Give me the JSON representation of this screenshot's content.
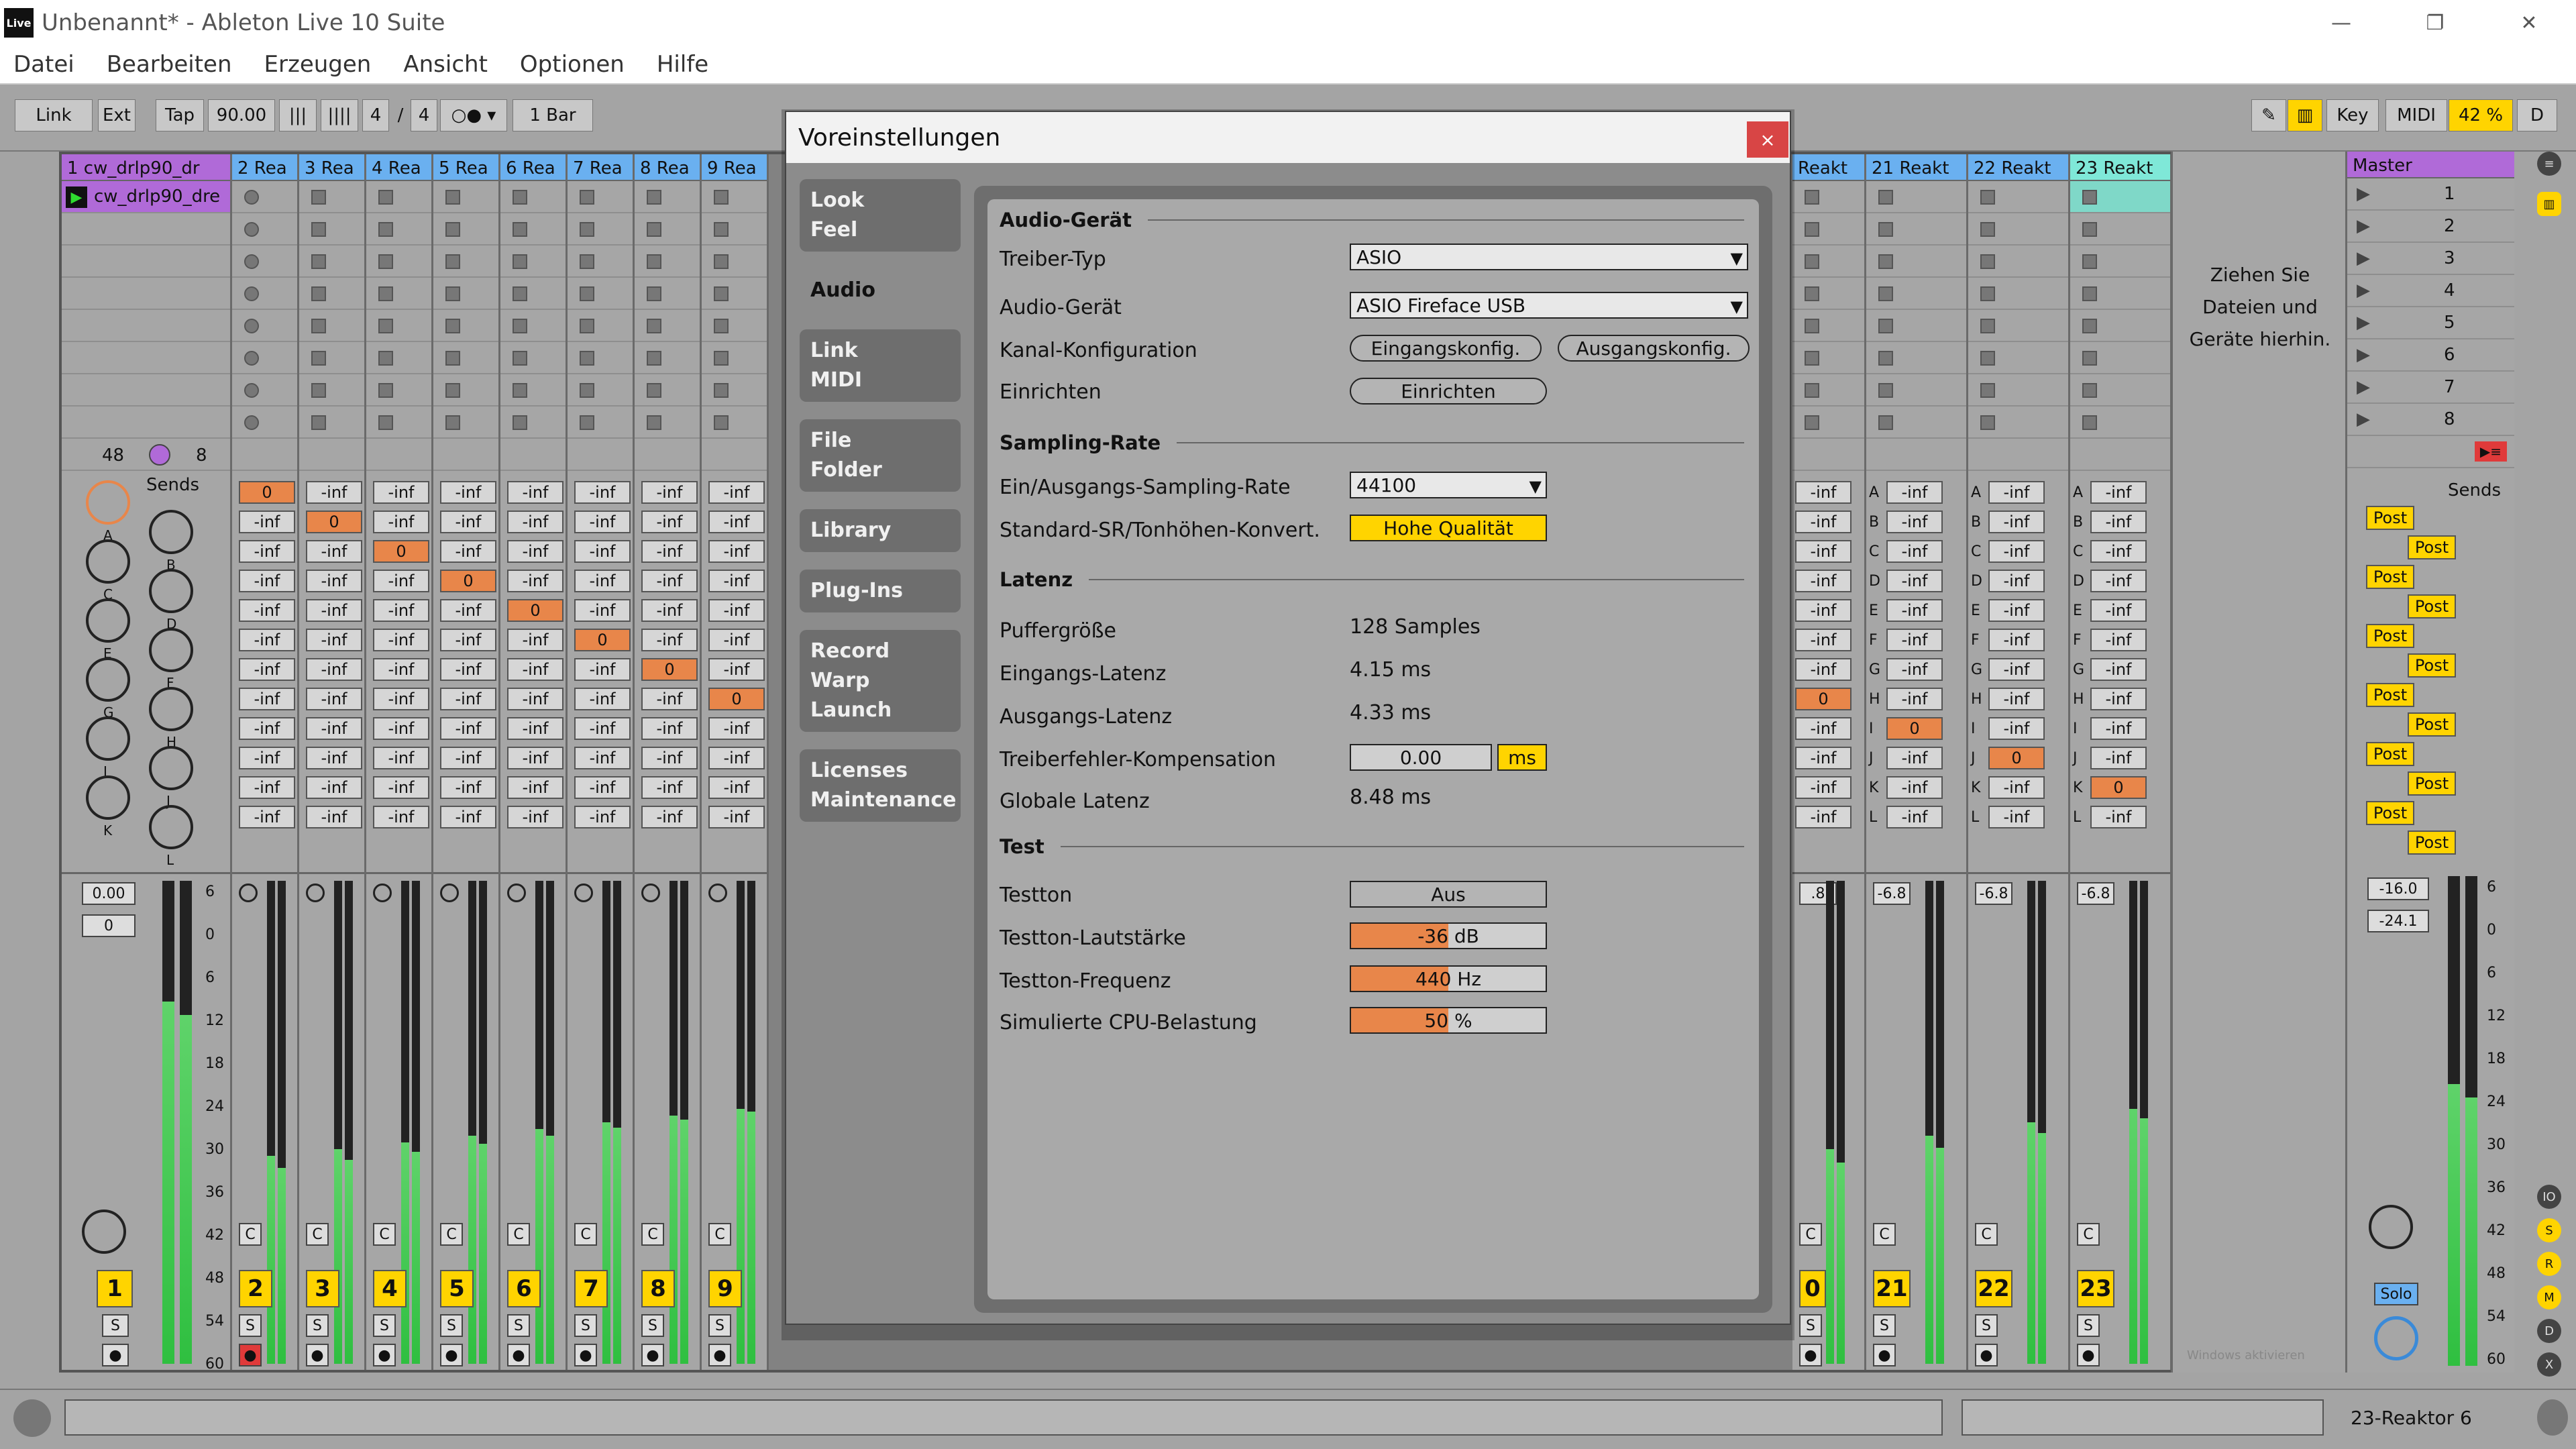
{
  "window": {
    "title": "Unbenannt* - Ableton Live 10 Suite",
    "logo_text": "Live",
    "minimize": "—",
    "restore": "❐",
    "close": "✕"
  },
  "menu": [
    "Datei",
    "Bearbeiten",
    "Erzeugen",
    "Ansicht",
    "Optionen",
    "Hilfe"
  ],
  "control_bar": {
    "link": "Link",
    "ext": "Ext",
    "tap": "Tap",
    "tempo": "90.00",
    "sig_num": "4",
    "sig_sep": "/",
    "sig_den": "4",
    "quantize": "1 Bar",
    "key": "Key",
    "midi": "MIDI",
    "cpu": "42 %",
    "d": "D"
  },
  "tracks": [
    {
      "name": "1 cw_drlp90_dr",
      "color": "#b06ad8",
      "number": "1",
      "clip": "cw_drlp90_dre"
    },
    {
      "name": "2 Rea",
      "color": "#6ab0f0",
      "number": "2"
    },
    {
      "name": "3 Rea",
      "color": "#6ab0f0",
      "number": "3"
    },
    {
      "name": "4 Rea",
      "color": "#6ab0f0",
      "number": "4"
    },
    {
      "name": "5 Rea",
      "color": "#6ab0f0",
      "number": "5"
    },
    {
      "name": "6 Rea",
      "color": "#6ab0f0",
      "number": "6"
    },
    {
      "name": "7 Rea",
      "color": "#6ab0f0",
      "number": "7"
    },
    {
      "name": "8 Rea",
      "color": "#6ab0f0",
      "number": "8"
    },
    {
      "name": "9 Rea",
      "color": "#6ab0f0",
      "number": "9"
    }
  ],
  "right_tracks": [
    {
      "name": "Reakt",
      "color": "#6ab0f0",
      "number": "0",
      "vol": ".8"
    },
    {
      "name": "21 Reakt",
      "color": "#6ab0f0",
      "number": "21",
      "vol": "-6.8"
    },
    {
      "name": "22 Reakt",
      "color": "#6ab0f0",
      "number": "22",
      "vol": "-6.8"
    },
    {
      "name": "23 Reakt",
      "color": "#7fe8d8",
      "number": "23",
      "vol": "-6.8"
    }
  ],
  "track1": {
    "in_count": "48",
    "out_count": "8",
    "vol": "0.00",
    "pan": "0",
    "sends_label": "Sends"
  },
  "send_value": "-inf",
  "send_zero": "0",
  "send_letters": [
    "A",
    "B",
    "C",
    "D",
    "E",
    "F",
    "G",
    "H",
    "I",
    "J",
    "K",
    "L"
  ],
  "master": {
    "name": "Master",
    "color": "#b06ad8",
    "scenes": [
      "1",
      "2",
      "3",
      "4",
      "5",
      "6",
      "7",
      "8"
    ],
    "sends_label": "Sends",
    "post": "Post",
    "vol": "-16.0",
    "peak": "-24.1",
    "solo": "Solo"
  },
  "drop_hint": [
    "Ziehen Sie",
    "Dateien und",
    "Geräte hierhin."
  ],
  "meter_scale": [
    "6",
    "0",
    "6",
    "12",
    "18",
    "24",
    "30",
    "36",
    "42",
    "48",
    "54",
    "60"
  ],
  "mixer_labels": {
    "c": "C",
    "s": "S"
  },
  "bottom": {
    "track_name": "23-Reaktor 6"
  },
  "activation_note": "Windows aktivieren",
  "prefs": {
    "title": "Voreinstellungen",
    "close": "×",
    "tabs": [
      {
        "label": "Look\nFeel",
        "active": false
      },
      {
        "label": "Audio",
        "active": true
      },
      {
        "label": "Link\nMIDI",
        "active": false
      },
      {
        "label": "File\nFolder",
        "active": false
      },
      {
        "label": "Library",
        "active": false
      },
      {
        "label": "Plug-Ins",
        "active": false
      },
      {
        "label": "Record\nWarp\nLaunch",
        "active": false
      },
      {
        "label": "Licenses\nMaintenance",
        "active": false
      }
    ],
    "sections": {
      "audio_device": "Audio-Gerät",
      "sampling": "Sampling-Rate",
      "latency": "Latenz",
      "test": "Test"
    },
    "driver_type_label": "Treiber-Typ",
    "driver_type_value": "ASIO",
    "audio_device_label": "Audio-Gerät",
    "audio_device_value": "ASIO Fireface USB",
    "channel_config_label": "Kanal-Konfiguration",
    "input_config": "Eingangskonfig.",
    "output_config": "Ausgangskonfig.",
    "setup_label": "Einrichten",
    "setup_button": "Einrichten",
    "sr_label": "Ein/Ausgangs-Sampling-Rate",
    "sr_value": "44100",
    "conv_label": "Standard-SR/Tonhöhen-Konvert.",
    "conv_value": "Hohe Qualität",
    "buffer_label": "Puffergröße",
    "buffer_value": "128 Samples",
    "in_lat_label": "Eingangs-Latenz",
    "in_lat_value": "4.15 ms",
    "out_lat_label": "Ausgangs-Latenz",
    "out_lat_value": "4.33 ms",
    "comp_label": "Treiberfehler-Kompensation",
    "comp_value": "0.00",
    "comp_unit": "ms",
    "global_lat_label": "Globale Latenz",
    "global_lat_value": "8.48 ms",
    "tone_label": "Testton",
    "tone_value": "Aus",
    "tone_vol_label": "Testton-Lautstärke",
    "tone_vol_value": "-36 dB",
    "tone_vol_fraction": 0.5,
    "tone_freq_label": "Testton-Frequenz",
    "tone_freq_value": "440 Hz",
    "tone_freq_fraction": 0.5,
    "cpu_label": "Simulierte CPU-Belastung",
    "cpu_value": "50 %",
    "cpu_fraction": 0.5
  }
}
